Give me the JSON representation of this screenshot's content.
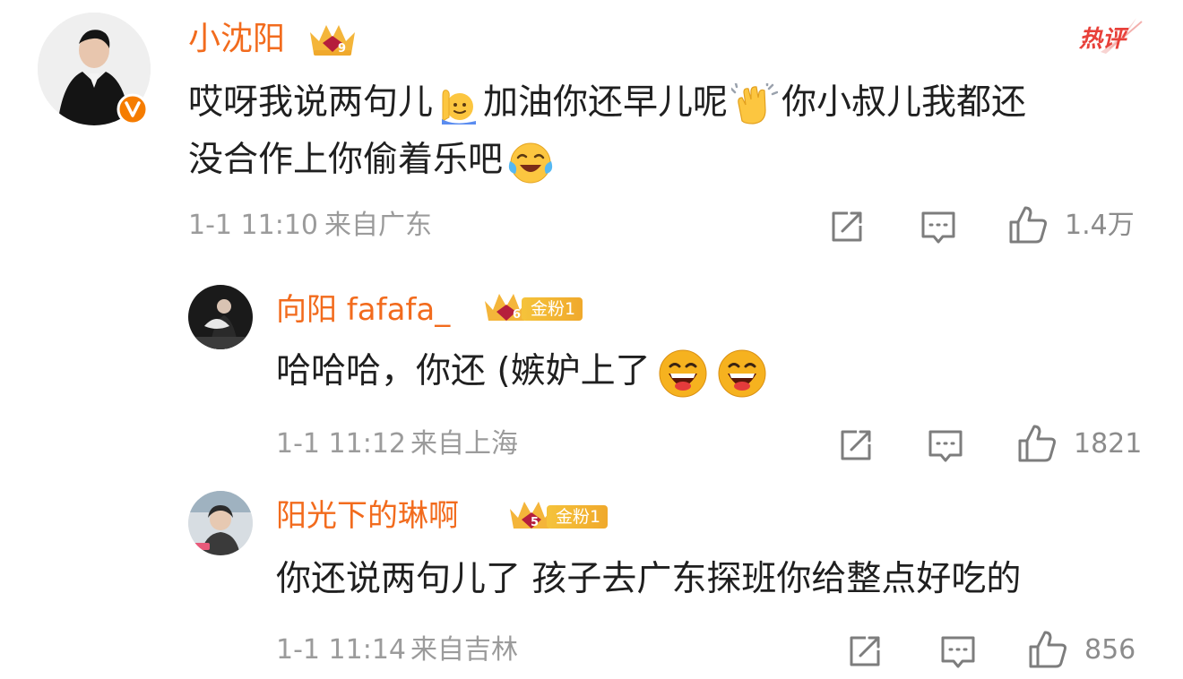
{
  "colors": {
    "username": "#f26b1d",
    "body_text": "#1f1f1f",
    "meta_text": "#9b9b9b",
    "hot_tag": "#e8413a",
    "badge_gold": "#f4b53a",
    "verified_badge": "#f57c00"
  },
  "main_comment": {
    "username": "小沈阳",
    "tag": "热评",
    "text_segments": [
      "哎呀我说两句儿",
      "加油你还早儿呢",
      "你小叔儿我都还",
      "没合作上你偷着乐吧"
    ],
    "emojis": [
      "raising-hand-emoji",
      "clapping-hands-emoji",
      "laughing-tears-emoji"
    ],
    "timestamp": "1-1 11:10",
    "location": "来自广东",
    "likes": "1.4万",
    "level_badge": "9"
  },
  "replies": [
    {
      "username": "向阳 fafafa_",
      "level_badge": "6",
      "fan_badge": "金粉1",
      "text": "哈哈哈，你还 (嫉妒上了",
      "emojis": [
        "grinning-emoji",
        "grinning-emoji"
      ],
      "timestamp": "1-1 11:12",
      "location": "来自上海",
      "likes": "1821"
    },
    {
      "username": "阳光下的琳啊",
      "level_badge": "5",
      "fan_badge": "金粉1",
      "text": "你还说两句儿了 孩子去广东探班你给整点好吃的",
      "timestamp": "1-1 11:14",
      "location": "来自吉林",
      "likes": "856"
    }
  ]
}
